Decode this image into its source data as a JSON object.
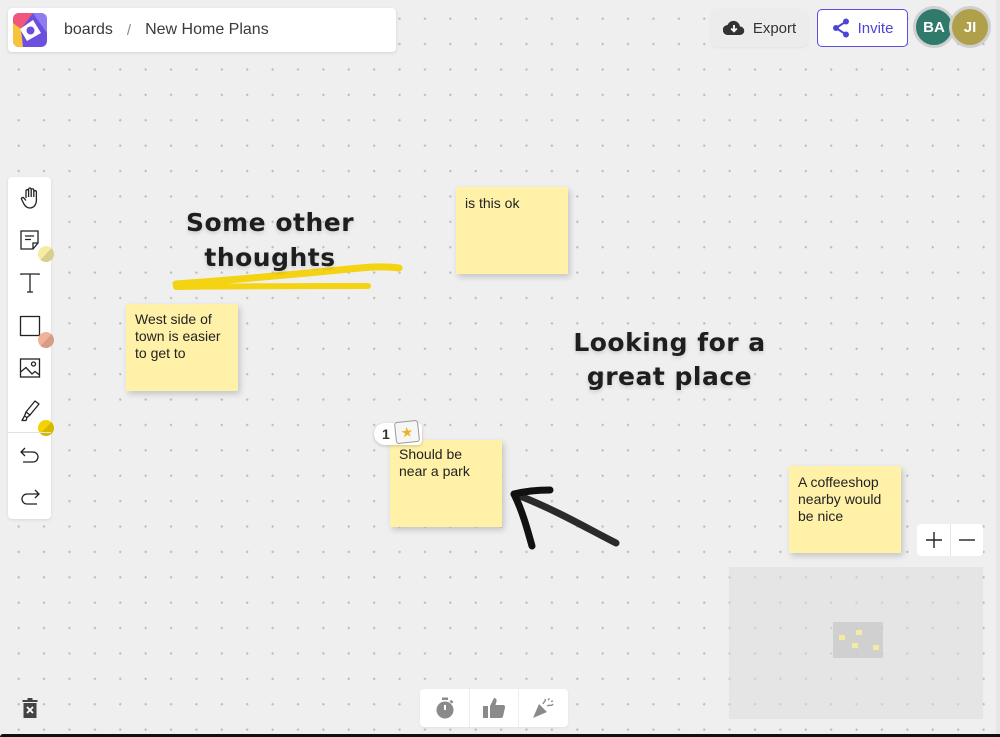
{
  "header": {
    "breadcrumb_root": "boards",
    "breadcrumb_separator": "/",
    "board_title": "New Home Plans",
    "export_label": "Export",
    "invite_label": "Invite",
    "accent_color": "#5a4fe0"
  },
  "collaborators": [
    {
      "initials": "BA",
      "color": "#2f7a6b"
    },
    {
      "initials": "JI",
      "color": "#b0a04a"
    }
  ],
  "toolbar": {
    "tools": [
      {
        "name": "hand",
        "icon": "hand-icon"
      },
      {
        "name": "sticky-note",
        "icon": "sticky-note-icon",
        "swatch": "#f6eba0"
      },
      {
        "name": "text",
        "icon": "text-icon"
      },
      {
        "name": "shape",
        "icon": "rectangle-icon",
        "swatch": "#f2b29a"
      },
      {
        "name": "image",
        "icon": "image-icon"
      },
      {
        "name": "marker",
        "icon": "marker-icon",
        "swatch": "#f5d100"
      },
      {
        "name": "undo",
        "icon": "undo-icon"
      },
      {
        "name": "redo",
        "icon": "redo-icon"
      }
    ]
  },
  "board": {
    "texts": [
      {
        "id": "heading-1",
        "line1": "Some other",
        "line2": "thoughts"
      },
      {
        "id": "heading-2",
        "line1": "Looking for a",
        "line2": "great place"
      }
    ],
    "stickies": [
      {
        "id": "note-1",
        "text": "is this ok"
      },
      {
        "id": "note-2",
        "text": "West side of town is easier to get to"
      },
      {
        "id": "note-3",
        "text": "Should be near a park",
        "votes": "1"
      },
      {
        "id": "note-4",
        "text": "A coffeeshop nearby would be nice"
      }
    ],
    "sticky_color": "#fff1a8",
    "highlight_color": "#f5d100"
  },
  "zoom": {
    "in_label": "+",
    "out_label": "−"
  },
  "reactions": [
    {
      "name": "timer",
      "icon": "stopwatch-icon"
    },
    {
      "name": "like",
      "icon": "thumbs-up-icon"
    },
    {
      "name": "celebrate",
      "icon": "party-popper-icon"
    }
  ]
}
